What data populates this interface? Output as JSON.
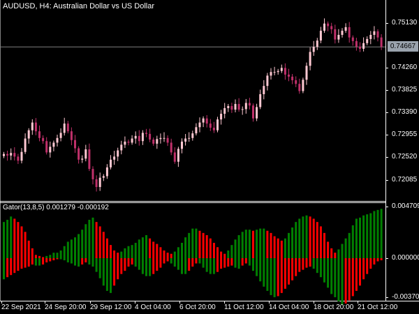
{
  "symbol_header": {
    "title": "AUDUSD, H4:  Australian Dollar vs US Dollar"
  },
  "price_axis": {
    "labels": [
      "0.75130",
      "0.74260",
      "0.73825",
      "0.73390",
      "0.72955",
      "0.72520",
      "0.72085"
    ],
    "current_price": "0.74667"
  },
  "indicator": {
    "title": "Gator(13,8,5) 0.001279 -0.000192",
    "axis_labels": [
      "0.004709",
      "0.000000",
      "-0.003705"
    ],
    "up_color": "#008000",
    "down_color": "#ff0000"
  },
  "time_axis": {
    "labels": [
      "22 Sep 2021",
      "24 Sep 20:00",
      "29 Sep 12:00",
      "4 Oct 04:00",
      "6 Oct 20:00",
      "11 Oct 12:00",
      "14 Oct 04:00",
      "18 Oct 20:00",
      "21 Oct 12:00"
    ]
  },
  "colors": {
    "background": "#000000",
    "text": "#ffffff",
    "bull_candle": "#ffc8d2",
    "bear_candle": "#c0306a",
    "grid_frame": "#ffffff",
    "bid_line": "#7f7f7f",
    "bid_tag_bg": "#9aa3ad"
  },
  "chart_data": {
    "type": "candlestick",
    "symbol": "AUDUSD",
    "timeframe": "H4",
    "ylim": [
      0.719,
      0.7554
    ],
    "current_price": 0.74667,
    "close_path": [
      0.7259,
      0.7256,
      0.7261,
      0.7254,
      0.7246,
      0.7263,
      0.7289,
      0.7305,
      0.732,
      0.7303,
      0.729,
      0.7284,
      0.7262,
      0.7273,
      0.7281,
      0.729,
      0.73,
      0.7318,
      0.7303,
      0.7286,
      0.727,
      0.7248,
      0.725,
      0.7268,
      0.723,
      0.721,
      0.7195,
      0.7213,
      0.7216,
      0.7233,
      0.7248,
      0.7254,
      0.7266,
      0.7277,
      0.7283,
      0.7281,
      0.7289,
      0.7294,
      0.7284,
      0.73,
      0.7298,
      0.7287,
      0.7279,
      0.7288,
      0.729,
      0.729,
      0.7281,
      0.7262,
      0.7244,
      0.7269,
      0.7283,
      0.7289,
      0.729,
      0.7299,
      0.7311,
      0.732,
      0.7328,
      0.7318,
      0.731,
      0.7305,
      0.7326,
      0.7337,
      0.7348,
      0.7352,
      0.7345,
      0.7356,
      0.7345,
      0.7346,
      0.7358,
      0.7353,
      0.7328,
      0.735,
      0.7375,
      0.7391,
      0.7411,
      0.7418,
      0.7418,
      0.742,
      0.7426,
      0.7413,
      0.7409,
      0.7402,
      0.7395,
      0.7381,
      0.7403,
      0.743,
      0.7457,
      0.7467,
      0.7479,
      0.7498,
      0.7512,
      0.7507,
      0.7501,
      0.7481,
      0.749,
      0.7498,
      0.7505,
      0.7485,
      0.7478,
      0.7467,
      0.7463,
      0.7474,
      0.7482,
      0.749,
      0.7497,
      0.7485,
      0.7467
    ],
    "gator": {
      "upper_values": [
        0.0033,
        0.0035,
        0.0038,
        0.0036,
        0.0033,
        0.0029,
        0.0024,
        0.0016,
        0.0009,
        0.0003,
        0.0002,
        0.0001,
        0.0002,
        0.0003,
        0.0005,
        0.0005,
        0.0007,
        0.0011,
        0.0015,
        0.0017,
        0.0019,
        0.0022,
        0.0026,
        0.0031,
        0.0035,
        0.0037,
        0.0033,
        0.0029,
        0.0024,
        0.0018,
        0.0012,
        0.0007,
        0.0005,
        0.0006,
        0.0009,
        0.0011,
        0.0012,
        0.0014,
        0.0017,
        0.0019,
        0.0021,
        0.0018,
        0.0015,
        0.0013,
        0.001,
        0.0007,
        0.0005,
        0.0004,
        0.0006,
        0.001,
        0.0014,
        0.0019,
        0.0023,
        0.0027,
        0.0027,
        0.0025,
        0.0023,
        0.0021,
        0.0018,
        0.0014,
        0.001,
        0.0006,
        0.0004,
        0.0007,
        0.0012,
        0.0017,
        0.0021,
        0.0024,
        0.0026,
        0.0026,
        0.0025,
        0.0026,
        0.0027,
        0.0027,
        0.0025,
        0.0023,
        0.002,
        0.0018,
        0.0016,
        0.0018,
        0.0023,
        0.0028,
        0.0033,
        0.0036,
        0.0038,
        0.0039,
        0.0038,
        0.0036,
        0.0033,
        0.0029,
        0.0023,
        0.0015,
        0.0009,
        0.0005,
        0.0008,
        0.0013,
        0.0018,
        0.0023,
        0.003,
        0.0036,
        0.0037,
        0.0039,
        0.004,
        0.0041,
        0.0043,
        0.0044,
        0.0045
      ],
      "lower_values": [
        -0.002,
        -0.0018,
        -0.0016,
        -0.0014,
        -0.0012,
        -0.001,
        -0.0009,
        -0.0008,
        -0.0006,
        -0.0007,
        -0.0007,
        -0.0006,
        -0.0004,
        -0.0003,
        -0.0002,
        -0.0001,
        -0.0001,
        -0.0002,
        -0.0004,
        -0.0005,
        -0.0007,
        -0.0008,
        -0.0006,
        -0.0004,
        -0.0006,
        -0.0008,
        -0.0013,
        -0.0019,
        -0.0026,
        -0.0031,
        -0.0033,
        -0.0026,
        -0.002,
        -0.0015,
        -0.0012,
        -0.0008,
        -0.0006,
        -0.0008,
        -0.0011,
        -0.0015,
        -0.0017,
        -0.0017,
        -0.0015,
        -0.0012,
        -0.0009,
        -0.0005,
        -0.0003,
        -0.0005,
        -0.0008,
        -0.0011,
        -0.0015,
        -0.0015,
        -0.0012,
        -0.0008,
        -0.0005,
        -0.0005,
        -0.0009,
        -0.0013,
        -0.0015,
        -0.0015,
        -0.0013,
        -0.001,
        -0.0009,
        -0.0008,
        -0.0007,
        -0.0009,
        -0.001,
        -0.0007,
        -0.0005,
        -0.0007,
        -0.0012,
        -0.0017,
        -0.0022,
        -0.0027,
        -0.0031,
        -0.0035,
        -0.0037,
        -0.0036,
        -0.0033,
        -0.0029,
        -0.0025,
        -0.0021,
        -0.0017,
        -0.0013,
        -0.0011,
        -0.0009,
        -0.0008,
        -0.001,
        -0.0014,
        -0.0018,
        -0.0023,
        -0.0028,
        -0.0034,
        -0.0037,
        -0.0041,
        -0.0044,
        -0.0043,
        -0.004,
        -0.0036,
        -0.0031,
        -0.0026,
        -0.002,
        -0.0015,
        -0.001,
        -0.0006,
        -0.0003,
        -0.0002
      ],
      "ylim": [
        -0.003705,
        0.004709
      ]
    }
  }
}
